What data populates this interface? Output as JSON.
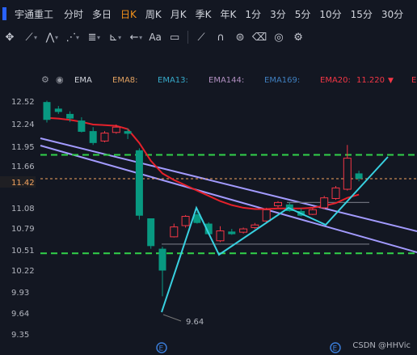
{
  "menu": {
    "symbol": "宇通重工",
    "tabs": [
      "分时",
      "多日",
      "日K",
      "周K",
      "月K",
      "季K",
      "年K",
      "1分",
      "3分",
      "5分",
      "10分",
      "15分",
      "30分"
    ],
    "active_tab": "日K"
  },
  "toolbar": {
    "icons": [
      "crosshair-icon",
      "trend-line-icon",
      "polyline-icon",
      "pattern-icon",
      "fib-retracement-icon",
      "ruler-icon",
      "arrow-left-icon",
      "text-icon",
      "comment-icon",
      "brush-icon",
      "magnet-icon",
      "lock-icon",
      "trash-icon",
      "visibility-icon",
      "settings-icon"
    ]
  },
  "indicator_bar": {
    "name": "EMA",
    "items": [
      {
        "label": "EMA8:",
        "color": "#e0a060"
      },
      {
        "label": "EMA13:",
        "color": "#36a9c9"
      },
      {
        "label": "EMA144:",
        "color": "#b08fc0"
      },
      {
        "label": "EMA169:",
        "color": "#3f7fbf"
      },
      {
        "label": "EMA20:",
        "value": "11.220",
        "color": "#f23645"
      }
    ]
  },
  "chart_data": {
    "type": "candlestick",
    "y_ticks": [
      "12.52",
      "12.24",
      "11.95",
      "11.66",
      "11.42",
      "11.08",
      "10.79",
      "10.51",
      "10.22",
      "9.93",
      "9.64",
      "9.35"
    ],
    "current_price": "11.42",
    "ylim": [
      9.2,
      12.7
    ],
    "low_annotation": "9.64",
    "colors": {
      "up": "#f23645",
      "down": "#089981",
      "ema20": "#e6212b",
      "channel": "#a39bff",
      "zigzag": "#38d0e0",
      "support": "#32d24a",
      "current_line": "#f4a460"
    },
    "candles": [
      {
        "o": 12.6,
        "h": 12.62,
        "l": 12.29,
        "c": 12.33
      },
      {
        "o": 12.5,
        "h": 12.54,
        "l": 12.42,
        "c": 12.45
      },
      {
        "o": 12.42,
        "h": 12.46,
        "l": 12.3,
        "c": 12.35
      },
      {
        "o": 12.32,
        "h": 12.37,
        "l": 12.14,
        "c": 12.15
      },
      {
        "o": 12.16,
        "h": 12.22,
        "l": 11.95,
        "c": 11.98
      },
      {
        "o": 12.01,
        "h": 12.16,
        "l": 11.99,
        "c": 12.13
      },
      {
        "o": 12.14,
        "h": 12.26,
        "l": 12.12,
        "c": 12.22
      },
      {
        "o": 12.16,
        "h": 12.2,
        "l": 12.04,
        "c": 12.12
      },
      {
        "o": 11.87,
        "h": 11.9,
        "l": 10.82,
        "c": 10.88
      },
      {
        "o": 10.84,
        "h": 10.84,
        "l": 10.38,
        "c": 10.42
      },
      {
        "o": 10.38,
        "h": 10.41,
        "l": 9.66,
        "c": 10.05
      },
      {
        "o": 10.56,
        "h": 10.76,
        "l": 10.55,
        "c": 10.71
      },
      {
        "o": 10.73,
        "h": 10.89,
        "l": 10.7,
        "c": 10.87
      },
      {
        "o": 10.9,
        "h": 10.94,
        "l": 10.76,
        "c": 10.77
      },
      {
        "o": 10.76,
        "h": 10.78,
        "l": 10.59,
        "c": 10.6
      },
      {
        "o": 10.5,
        "h": 10.72,
        "l": 10.48,
        "c": 10.65
      },
      {
        "o": 10.64,
        "h": 10.68,
        "l": 10.59,
        "c": 10.6
      },
      {
        "o": 10.63,
        "h": 10.7,
        "l": 10.61,
        "c": 10.68
      },
      {
        "o": 10.7,
        "h": 10.77,
        "l": 10.68,
        "c": 10.74
      },
      {
        "o": 10.8,
        "h": 11.0,
        "l": 10.78,
        "c": 10.97
      },
      {
        "o": 11.03,
        "h": 11.1,
        "l": 11.0,
        "c": 11.08
      },
      {
        "o": 11.05,
        "h": 11.08,
        "l": 10.94,
        "c": 10.95
      },
      {
        "o": 10.95,
        "h": 10.99,
        "l": 10.87,
        "c": 10.88
      },
      {
        "o": 10.9,
        "h": 11.0,
        "l": 10.89,
        "c": 10.97
      },
      {
        "o": 11.0,
        "h": 11.18,
        "l": 10.98,
        "c": 11.15
      },
      {
        "o": 11.14,
        "h": 11.33,
        "l": 11.12,
        "c": 11.3
      },
      {
        "o": 11.28,
        "h": 11.95,
        "l": 11.26,
        "c": 11.75
      },
      {
        "o": 11.52,
        "h": 11.56,
        "l": 11.4,
        "c": 11.44
      }
    ],
    "ema20": [
      12.36,
      12.35,
      12.33,
      12.3,
      12.26,
      12.25,
      12.24,
      12.19,
      11.98,
      11.71,
      11.52,
      11.42,
      11.34,
      11.26,
      11.18,
      11.1,
      11.04,
      11.0,
      10.98,
      10.98,
      10.99,
      10.99,
      10.99,
      11.0,
      11.03,
      11.07,
      11.15,
      11.2
    ]
  },
  "footer": {
    "text": "CSDN @HHVic"
  }
}
